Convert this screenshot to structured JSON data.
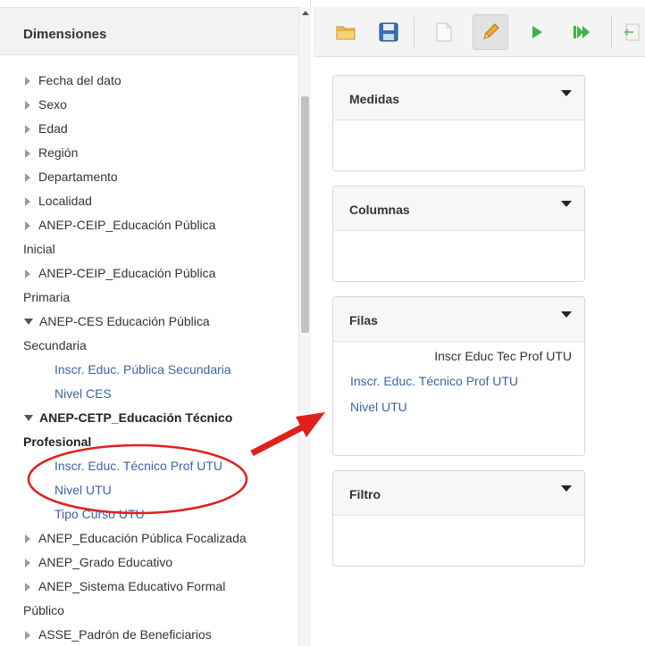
{
  "left_panel": {
    "title": "Dimensiones",
    "tree": [
      {
        "label": "Fecha del dato",
        "type": "collapsed"
      },
      {
        "label": "Sexo",
        "type": "collapsed"
      },
      {
        "label": "Edad",
        "type": "collapsed"
      },
      {
        "label": "Región",
        "type": "collapsed"
      },
      {
        "label": "Departamento",
        "type": "collapsed"
      },
      {
        "label": "Localidad",
        "type": "collapsed"
      },
      {
        "label": "ANEP-CEIP_Educación Pública",
        "label_cont": "Inicial",
        "type": "collapsed"
      },
      {
        "label": "ANEP-CEIP_Educación Pública",
        "label_cont": "Primaria",
        "type": "collapsed"
      },
      {
        "label": "ANEP-CES Educación Pública",
        "label_cont": "Secundaria",
        "type": "expanded",
        "children": [
          "Inscr. Educ. Pública Secundaria",
          "Nivel CES"
        ]
      },
      {
        "label": "ANEP-CETP_Educación Técnico",
        "label_cont": "Profesional",
        "type": "expanded",
        "children": [
          "Inscr. Educ. Técnico Prof UTU",
          "Nivel UTU",
          "Tipo Curso UTU"
        ]
      },
      {
        "label": "ANEP_Educación Pública Focalizada",
        "type": "collapsed"
      },
      {
        "label": "ANEP_Grado Educativo",
        "type": "collapsed"
      },
      {
        "label": "ANEP_Sistema Educativo Formal",
        "label_cont": "Público",
        "type": "collapsed"
      },
      {
        "label": "ASSE_Padrón de Beneficiarios",
        "type": "collapsed"
      }
    ]
  },
  "toolbar": {
    "buttons": [
      {
        "name": "open-folder",
        "icon": "folder-icon"
      },
      {
        "name": "save",
        "icon": "floppy-disk-icon"
      },
      {
        "name": "new-document",
        "icon": "document-icon"
      },
      {
        "name": "edit",
        "icon": "pencil-icon",
        "active": true
      },
      {
        "name": "run",
        "icon": "play-icon"
      },
      {
        "name": "run-all",
        "icon": "fast-forward-icon"
      },
      {
        "name": "export",
        "icon": "export-icon"
      }
    ]
  },
  "cards": {
    "measures": {
      "title": "Medidas"
    },
    "columns": {
      "title": "Columnas"
    },
    "rows": {
      "title": "Filas",
      "header_item": "Inscr Educ Tec Prof UTU",
      "items": [
        "Inscr. Educ. Técnico Prof UTU",
        "Nivel UTU"
      ]
    },
    "filter": {
      "title": "Filtro"
    }
  },
  "colors": {
    "link_blue": "#3d63a6",
    "annotation_red": "#e0201b",
    "play_green": "#3cb34a"
  }
}
